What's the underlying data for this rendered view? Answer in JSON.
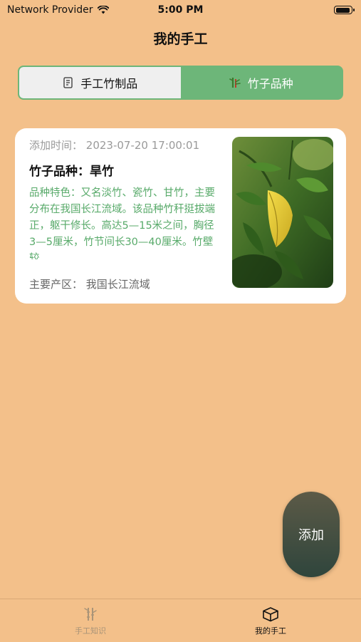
{
  "status": {
    "carrier": "Network Provider",
    "time": "5:00 PM"
  },
  "nav": {
    "title": "我的手工"
  },
  "segments": [
    {
      "label": "手工竹制品",
      "icon": "bamboo-doc-icon"
    },
    {
      "label": "竹子品种",
      "icon": "bamboo-plant-icon"
    }
  ],
  "card": {
    "time_label": "添加时间：",
    "time_value": "2023-07-20 17:00:01",
    "name_label": "竹子品种：",
    "name_value": "旱竹",
    "description": "品种特色：又名淡竹、瓷竹、甘竹，主要分布在我国长江流域。该品种竹秆挺拔端正，躯干修长。高达5—15米之间，胸径3—5厘米，竹节间长30—40厘米。竹壁较...",
    "region_label": "主要产区：",
    "region_value": "我国长江流域"
  },
  "add_button": {
    "label": "添加"
  },
  "tabs": [
    {
      "label": "手工知识",
      "icon": "bamboo-icon",
      "active": false
    },
    {
      "label": "我的手工",
      "icon": "box-icon",
      "active": true
    }
  ],
  "colors": {
    "background": "#F3C08A",
    "accent": "#6DB679",
    "description": "#58AA6A"
  }
}
